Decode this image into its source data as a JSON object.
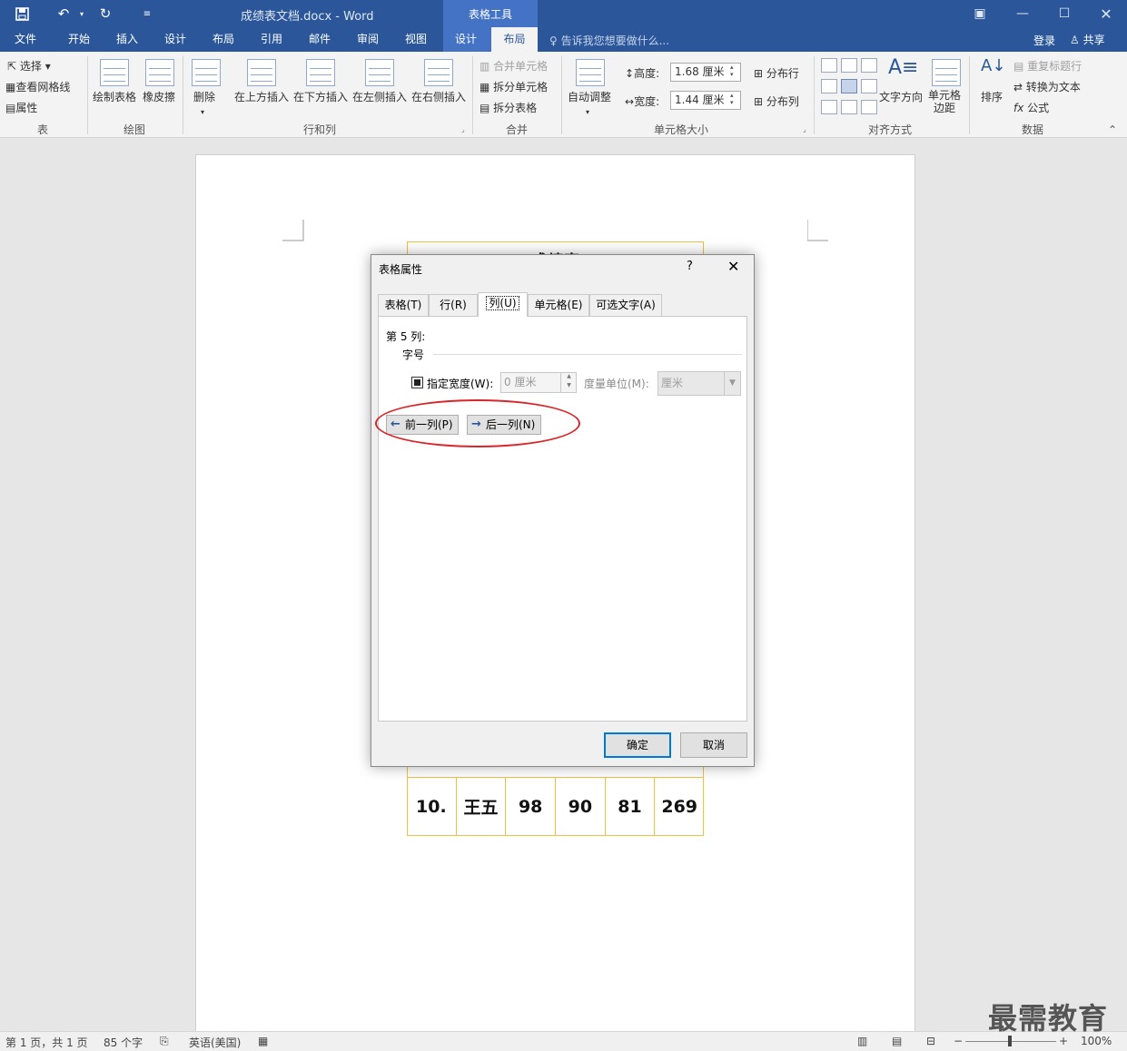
{
  "window": {
    "doc_title": "成绩表文档.docx - Word",
    "context_tools": "表格工具"
  },
  "qat": {
    "save": "save-icon",
    "undo": "undo-icon",
    "redo": "redo-icon",
    "customize": "customize-icon"
  },
  "tabs": [
    "文件",
    "开始",
    "插入",
    "设计",
    "布局",
    "引用",
    "邮件",
    "审阅",
    "视图",
    "设计",
    "布局"
  ],
  "tell_me": "告诉我您想要做什么...",
  "login": "登录",
  "share": "共享",
  "ribbon": {
    "table": {
      "select": "选择",
      "gridlines": "查看网格线",
      "properties": "属性",
      "label": "表"
    },
    "draw": {
      "draw_table": "绘制表格",
      "eraser": "橡皮擦",
      "label": "绘图"
    },
    "rows_cols": {
      "delete": "删除",
      "insert_above": "在上方插入",
      "insert_below": "在下方插入",
      "insert_left": "在左侧插入",
      "insert_right": "在右侧插入",
      "label": "行和列"
    },
    "merge": {
      "merge_cells": "合并单元格",
      "split_cells": "拆分单元格",
      "split_table": "拆分表格",
      "label": "合并"
    },
    "cell_size": {
      "autofit": "自动调整",
      "height_label": "高度:",
      "height_value": "1.68 厘米",
      "width_label": "宽度:",
      "width_value": "1.44 厘米",
      "distribute_rows": "分布行",
      "distribute_cols": "分布列",
      "label": "单元格大小"
    },
    "alignment": {
      "text_direction": "文字方向",
      "cell_margins_1": "单元格",
      "cell_margins_2": "边距",
      "label": "对齐方式"
    },
    "data": {
      "sort": "排序",
      "repeat_header": "重复标题行",
      "convert_text": "转换为文本",
      "formula": "公式",
      "label": "数据"
    }
  },
  "document": {
    "title_partial": "成绩表",
    "last_row": [
      "10.",
      "王五",
      "98",
      "90",
      "81",
      "269"
    ]
  },
  "dialog": {
    "title": "表格属性",
    "help": "?",
    "close": "✕",
    "tabs": [
      "表格(T)",
      "行(R)",
      "列(U)",
      "单元格(E)",
      "可选文字(A)"
    ],
    "column_label": "第 5 列:",
    "size_section": "字号",
    "specify_width": "指定宽度(W):",
    "width_value": "0 厘米",
    "unit_label": "度量单位(M):",
    "unit_value": "厘米",
    "prev_col": "前一列(P)",
    "next_col": "后一列(N)",
    "ok": "确定",
    "cancel": "取消"
  },
  "status": {
    "page": "第 1 页，共 1 页",
    "words": "85 个字",
    "language": "英语(美国)",
    "zoom": "100%"
  },
  "watermark": "最需教育",
  "colors": {
    "accent": "#2b579a",
    "table_border": "#f0c040",
    "annotation": "#d9262b"
  }
}
